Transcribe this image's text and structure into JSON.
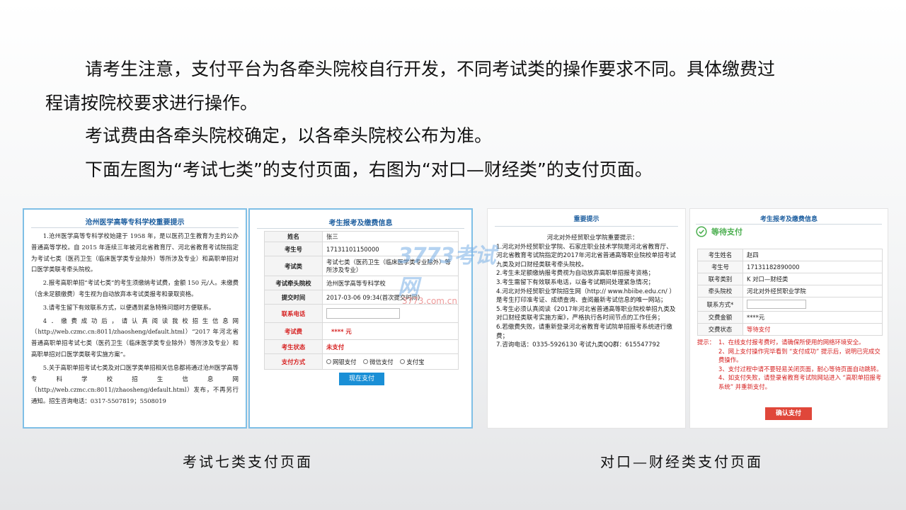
{
  "intro": {
    "line1": "请考生注意，支付平台为各牵头院校自行开发，不同考试类的操作要求不同。具体缴费过",
    "line2": "程请按院校要求进行操作。",
    "line3": "考试费由各牵头院校确定，以各牵头院校公布为准。",
    "line4": "下面左图为“考试七类”的支付页面，右图为“对口—财经类”的支付页面。"
  },
  "left_notice": {
    "title": "沧州医学高等专科学校重要提示",
    "p1": "1.沧州医学高等专科学校始建于 1958 年，是以医药卫生教育为主的公办普通高等学校。自 2015 年连续三年被河北省教育厅、河北省教育考试院指定为考试七类（医药卫生（临床医学类专业除外）等所涉及专业）和高职单招对口医学类联考牵头院校。",
    "p2": "2.报考高职单招“考试七类”的考生须缴纳考试费，金额 150 元/人。未缴费（含未足额缴费）考生视为自动放弃本考试类报考和录取资格。",
    "p3": "3.请考生留下有效联系方式，以便遇到紧急特殊问题时方便联系。",
    "p4": "4．缴费成功后，请认真阅读我校招生信息网（http://web.czmc.cn:8011/zhaosheng/default.html）“2017 年河北省普通高职单招考试七类（医药卫生（临床医学类专业除外）等所涉及专业）和高职单招对口医学类联考实施方案”。",
    "p5": "5.关于高职单招考试七类及对口医学类单招相关信息都将通过沧州医学高等专科学校招生信息网（http://web.czmc.cn:8011//zhaosheng/default.html）发布，不再另行通知。招生咨询电话：0317-5507819；5508019"
  },
  "left_form": {
    "title": "考生报考及缴费信息",
    "rows": [
      {
        "label": "姓名",
        "value": "张三"
      },
      {
        "label": "考生号",
        "value": "17131101150000"
      },
      {
        "label": "考试类",
        "value": "考试七类（医药卫生（临床医学类专业除外）等所涉及专业）"
      },
      {
        "label": "考试牵头院校",
        "value": "沧州医学高等专科学校"
      },
      {
        "label": "提交时间",
        "value": "2017-03-06 09:34(首次提交时间)"
      },
      {
        "label": "联系电话",
        "value": ""
      },
      {
        "label": "考试费",
        "value": "****  元"
      },
      {
        "label": "考生状态",
        "value": "未支付"
      },
      {
        "label": "支付方式",
        "value": ""
      }
    ],
    "pay_options": [
      "网银支付",
      "微信支付",
      "支付宝"
    ],
    "submit_label": "现在支付"
  },
  "right_notice": {
    "title": "重要提示",
    "heading": "河北对外经贸职业学院重要提示：",
    "items": [
      "1.河北对外经贸职业学院、石家庄职业技术学院是河北省教育厅、河北省教育考试院指定的2017年河北省普通高等职业院校单招考试九类及对口财经类联考牵头院校。",
      "2.考生未足额缴纳报考费视为自动放弃高职单招报考资格；",
      "3.考生需留下有效联系电话，以备考试期间处理紧急情况；",
      "4.河北对外经贸职业学院招生网（http:// www.hbiibe.edu.cn/ ）是考生打印准考证、成绩查询、查阅最新考试信息的唯一网站；",
      "5.考生必须认真阅读《2017年河北省普通高等职业院校单招九类及对口财经类联考实施方案》，严格执行各时间节点的工作任务；",
      "6.若缴费失败，请重新登录河北省教育考试院单招报考系统进行缴费；",
      "7.咨询电话：0335-5926130     考试九类QQ群：615547792"
    ]
  },
  "right_form": {
    "title": "考生报考及缴费信息",
    "status_title": "等待支付",
    "rows": [
      {
        "label": "考生姓名",
        "value": "赵四"
      },
      {
        "label": "考生号",
        "value": "17131182890000"
      },
      {
        "label": "联考类别",
        "value": "K 对口—财经类"
      },
      {
        "label": "牵头院校",
        "value": "河北对外经贸职业学院"
      },
      {
        "label": "联系方式*",
        "value": ""
      },
      {
        "label": "交费金额",
        "value": "****元"
      },
      {
        "label": "交费状态",
        "value": "等待支付"
      }
    ],
    "tips_label": "提示：",
    "tips": [
      "1、在线支付报考费时，请确保所使用的网络环境安全。",
      "2、网上支付操作完毕看到 “支付成功” 提示后，说明已完成交费操作。",
      "3、支付过程中请不要轻易关闭页面，耐心等待页面自动跳转。",
      "4、如支付失败，请登录省教育考试院网站进入 “高职单招报考系统” 并重新支付。"
    ],
    "confirm_label": "确认支付"
  },
  "captions": {
    "left": "考试七类支付页面",
    "right": "对口—财经类支付页面"
  },
  "watermark": {
    "brand": "3773考试网",
    "domain": "3773.com.cn"
  },
  "colors": {
    "blue_button": "#1a8fd6",
    "red_button": "#e0473a",
    "title_blue": "#1e5fa0",
    "alert_red": "#d62020",
    "success_green": "#4caf50"
  }
}
